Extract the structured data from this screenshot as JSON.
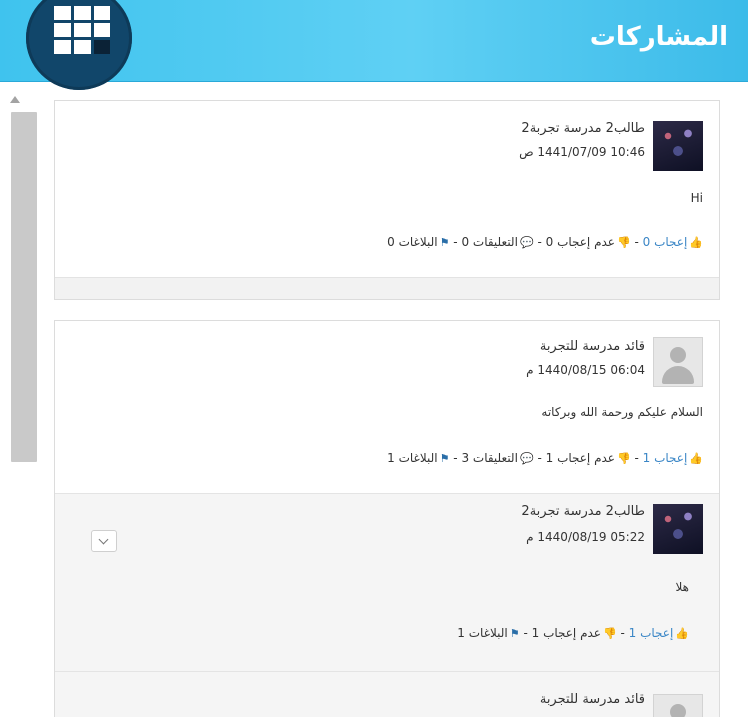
{
  "header": {
    "title": "المشاركات",
    "logo_icon": "windows-tiles-icon",
    "colors": {
      "bar": "#46c4ef",
      "badge": "#11466a"
    }
  },
  "posts": [
    {
      "author": "طالب2 مدرسة تجربة2",
      "date": "10:46 1441/07/09 ص",
      "content": "Hi",
      "avatar": "photo",
      "actions": {
        "like_label": "إعجاب 0",
        "dislike_label": "عدم إعجاب 0",
        "comments_label": "التعليقات 0",
        "reports_label": "البلاغات 0"
      }
    },
    {
      "author": "قائد مدرسة للتجربة",
      "date": "06:04 1440/08/15 م",
      "content": "السلام عليكم ورحمة الله وبركاته",
      "avatar": "default",
      "actions": {
        "like_label": "إعجاب 1",
        "dislike_label": "عدم إعجاب 1",
        "comments_label": "التعليقات 3",
        "reports_label": "البلاغات 1"
      },
      "replies": [
        {
          "author": "طالب2 مدرسة تجربة2",
          "date": "05:22 1440/08/19 م",
          "content": "هلا",
          "avatar": "photo",
          "actions": {
            "like_label": "إعجاب 1",
            "dislike_label": "عدم إعجاب 1",
            "reports_label": "البلاغات 1"
          }
        },
        {
          "author": "قائد مدرسة للتجربة",
          "avatar": "default"
        }
      ]
    }
  ],
  "separator": " - "
}
